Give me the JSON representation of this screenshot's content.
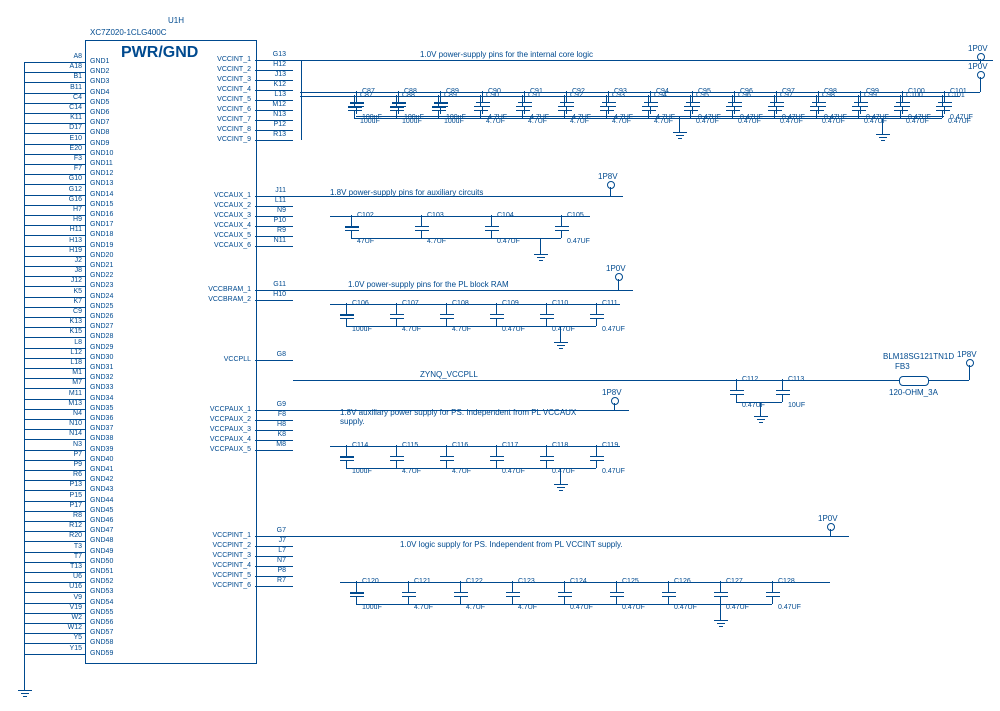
{
  "chip": {
    "ref": "U1H",
    "part": "XC7Z020-1CLG400C",
    "title": "PWR/GND",
    "gnd_pins": [
      {
        "num": "A8",
        "name": "GND1"
      },
      {
        "num": "A18",
        "name": "GND2"
      },
      {
        "num": "B1",
        "name": "GND3"
      },
      {
        "num": "B11",
        "name": "GND4"
      },
      {
        "num": "C4",
        "name": "GND5"
      },
      {
        "num": "C14",
        "name": "GND6"
      },
      {
        "num": "K11",
        "name": "GND7"
      },
      {
        "num": "D17",
        "name": "GND8"
      },
      {
        "num": "E10",
        "name": "GND9"
      },
      {
        "num": "E20",
        "name": "GND10"
      },
      {
        "num": "F3",
        "name": "GND11"
      },
      {
        "num": "F7",
        "name": "GND12"
      },
      {
        "num": "G10",
        "name": "GND13"
      },
      {
        "num": "G12",
        "name": "GND14"
      },
      {
        "num": "G16",
        "name": "GND15"
      },
      {
        "num": "H7",
        "name": "GND16"
      },
      {
        "num": "H9",
        "name": "GND17"
      },
      {
        "num": "H11",
        "name": "GND18"
      },
      {
        "num": "H13",
        "name": "GND19"
      },
      {
        "num": "H19",
        "name": "GND20"
      },
      {
        "num": "J2",
        "name": "GND21"
      },
      {
        "num": "J8",
        "name": "GND22"
      },
      {
        "num": "J12",
        "name": "GND23"
      },
      {
        "num": "K5",
        "name": "GND24"
      },
      {
        "num": "K7",
        "name": "GND25"
      },
      {
        "num": "C9",
        "name": "GND26"
      },
      {
        "num": "K13",
        "name": "GND27"
      },
      {
        "num": "K15",
        "name": "GND28"
      },
      {
        "num": "L8",
        "name": "GND29"
      },
      {
        "num": "L12",
        "name": "GND30"
      },
      {
        "num": "L18",
        "name": "GND31"
      },
      {
        "num": "M1",
        "name": "GND32"
      },
      {
        "num": "M7",
        "name": "GND33"
      },
      {
        "num": "M11",
        "name": "GND34"
      },
      {
        "num": "M13",
        "name": "GND35"
      },
      {
        "num": "N4",
        "name": "GND36"
      },
      {
        "num": "N10",
        "name": "GND37"
      },
      {
        "num": "N14",
        "name": "GND38"
      },
      {
        "num": "N3",
        "name": "GND39"
      },
      {
        "num": "P7",
        "name": "GND40"
      },
      {
        "num": "P9",
        "name": "GND41"
      },
      {
        "num": "R6",
        "name": "GND42"
      },
      {
        "num": "P13",
        "name": "GND43"
      },
      {
        "num": "P15",
        "name": "GND44"
      },
      {
        "num": "P17",
        "name": "GND45"
      },
      {
        "num": "R8",
        "name": "GND46"
      },
      {
        "num": "R12",
        "name": "GND47"
      },
      {
        "num": "R20",
        "name": "GND48"
      },
      {
        "num": "T3",
        "name": "GND49"
      },
      {
        "num": "T7",
        "name": "GND50"
      },
      {
        "num": "T13",
        "name": "GND51"
      },
      {
        "num": "U6",
        "name": "GND52"
      },
      {
        "num": "U16",
        "name": "GND53"
      },
      {
        "num": "V9",
        "name": "GND54"
      },
      {
        "num": "V19",
        "name": "GND55"
      },
      {
        "num": "W2",
        "name": "GND56"
      },
      {
        "num": "W12",
        "name": "GND57"
      },
      {
        "num": "Y5",
        "name": "GND58"
      },
      {
        "num": "Y15",
        "name": "GND59"
      }
    ],
    "vccint_pins": [
      {
        "num": "G13",
        "name": "VCCINT_1"
      },
      {
        "num": "H12",
        "name": "VCCINT_2"
      },
      {
        "num": "J13",
        "name": "VCCINT_3"
      },
      {
        "num": "K12",
        "name": "VCCINT_4"
      },
      {
        "num": "L13",
        "name": "VCCINT_5"
      },
      {
        "num": "M12",
        "name": "VCCINT_6"
      },
      {
        "num": "N13",
        "name": "VCCINT_7"
      },
      {
        "num": "P12",
        "name": "VCCINT_8"
      },
      {
        "num": "R13",
        "name": "VCCINT_9"
      }
    ],
    "vccaux_pins": [
      {
        "num": "J11",
        "name": "VCCAUX_1"
      },
      {
        "num": "L11",
        "name": "VCCAUX_2"
      },
      {
        "num": "N9",
        "name": "VCCAUX_3"
      },
      {
        "num": "P10",
        "name": "VCCAUX_4"
      },
      {
        "num": "R9",
        "name": "VCCAUX_5"
      },
      {
        "num": "N11",
        "name": "VCCAUX_6"
      }
    ],
    "vccbram_pins": [
      {
        "num": "G11",
        "name": "VCCBRAM_1"
      },
      {
        "num": "H10",
        "name": "VCCBRAM_2"
      }
    ],
    "vccpll_pin": {
      "num": "G8",
      "name": "VCCPLL"
    },
    "vccpaux_pins": [
      {
        "num": "G9",
        "name": "VCCPAUX_1"
      },
      {
        "num": "F8",
        "name": "VCCPAUX_2"
      },
      {
        "num": "H8",
        "name": "VCCPAUX_3"
      },
      {
        "num": "K8",
        "name": "VCCPAUX_4"
      },
      {
        "num": "M8",
        "name": "VCCPAUX_5"
      }
    ],
    "vccpint_pins": [
      {
        "num": "G7",
        "name": "VCCPINT_1"
      },
      {
        "num": "J7",
        "name": "VCCPINT_2"
      },
      {
        "num": "L7",
        "name": "VCCPINT_3"
      },
      {
        "num": "N7",
        "name": "VCCPINT_4"
      },
      {
        "num": "P8",
        "name": "VCCPINT_5"
      },
      {
        "num": "R7",
        "name": "VCCPINT_6"
      }
    ]
  },
  "notes": {
    "vccint": "1.0V power-supply pins for the internal core logic",
    "vccaux": "1.8V power-supply pins for auxiliary circuits",
    "vccbram": "1.0V power-supply pins for the PL block RAM",
    "vccpll_net": "ZYNQ_VCCPLL",
    "vccpaux": "1.8V auxiliary power supply for PS. Independent from PL VCCAUX supply.",
    "vccpint": "1.0V logic supply for PS. Independent from PL VCCINT supply."
  },
  "rails": {
    "v1p0": "1P0V",
    "v1p8": "1P8V"
  },
  "ferrite": {
    "ref": "FB3",
    "part": "BLM18SG121TN1D",
    "val": "120-OHM_3A"
  },
  "caps": {
    "vccint": [
      {
        "ref": "C87",
        "val": "100uF",
        "pol": true
      },
      {
        "ref": "C88",
        "val": "100uF",
        "pol": true
      },
      {
        "ref": "C89",
        "val": "100uF",
        "pol": true
      },
      {
        "ref": "C90",
        "val": "4.7UF"
      },
      {
        "ref": "C91",
        "val": "4.7UF"
      },
      {
        "ref": "C92",
        "val": "4.7UF"
      },
      {
        "ref": "C93",
        "val": "4.7UF"
      },
      {
        "ref": "C94",
        "val": "4.7UF"
      },
      {
        "ref": "C95",
        "val": "0.47UF"
      },
      {
        "ref": "C96",
        "val": "0.47UF"
      },
      {
        "ref": "C97",
        "val": "0.47UF"
      },
      {
        "ref": "C98",
        "val": "0.47UF"
      },
      {
        "ref": "C99",
        "val": "0.47UF"
      },
      {
        "ref": "C100",
        "val": "0.47UF"
      },
      {
        "ref": "C101",
        "val": "0.47UF"
      }
    ],
    "vccaux": [
      {
        "ref": "C102",
        "val": "47UF",
        "pol": true
      },
      {
        "ref": "C103",
        "val": "4.7UF"
      },
      {
        "ref": "C104",
        "val": "0.47UF"
      },
      {
        "ref": "C105",
        "val": "0.47UF"
      }
    ],
    "vccbram": [
      {
        "ref": "C106",
        "val": "100uF",
        "pol": true
      },
      {
        "ref": "C107",
        "val": "4.7UF"
      },
      {
        "ref": "C108",
        "val": "4.7UF"
      },
      {
        "ref": "C109",
        "val": "0.47UF"
      },
      {
        "ref": "C110",
        "val": "0.47UF"
      },
      {
        "ref": "C111",
        "val": "0.47UF"
      }
    ],
    "vccpll_net": [
      {
        "ref": "C112",
        "val": "0.47UF"
      },
      {
        "ref": "C113",
        "val": "10UF"
      }
    ],
    "vccpaux": [
      {
        "ref": "C114",
        "val": "100uF",
        "pol": true
      },
      {
        "ref": "C115",
        "val": "4.7UF"
      },
      {
        "ref": "C116",
        "val": "4.7UF"
      },
      {
        "ref": "C117",
        "val": "0.47UF"
      },
      {
        "ref": "C118",
        "val": "0.47UF"
      },
      {
        "ref": "C119",
        "val": "0.47UF"
      }
    ],
    "vccpint": [
      {
        "ref": "C120",
        "val": "100uF",
        "pol": true
      },
      {
        "ref": "C121",
        "val": "4.7UF"
      },
      {
        "ref": "C122",
        "val": "4.7UF"
      },
      {
        "ref": "C123",
        "val": "4.7UF"
      },
      {
        "ref": "C124",
        "val": "0.47UF"
      },
      {
        "ref": "C125",
        "val": "0.47UF"
      },
      {
        "ref": "C126",
        "val": "0.47UF"
      },
      {
        "ref": "C127",
        "val": "0.47UF"
      },
      {
        "ref": "C128",
        "val": "0.47UF"
      }
    ]
  }
}
